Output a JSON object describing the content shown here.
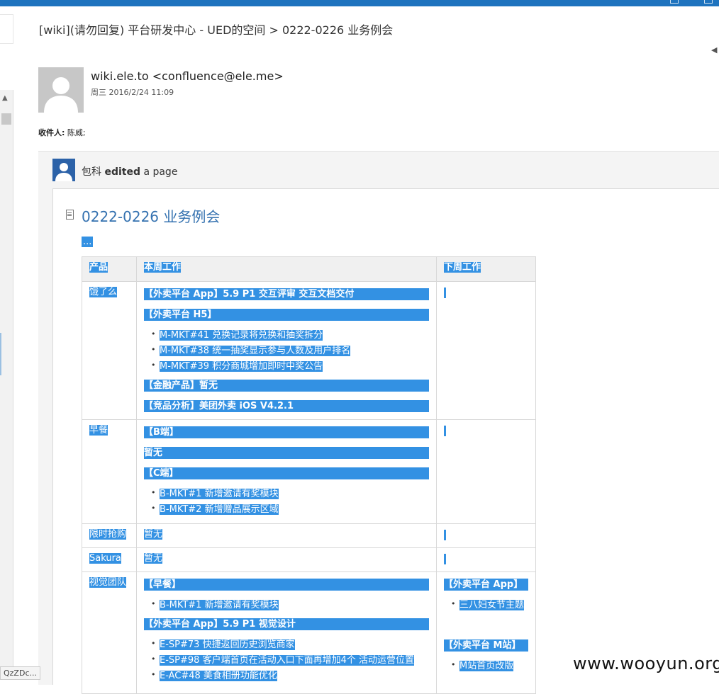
{
  "email": {
    "subject": "[wiki](请勿回复) 平台研发中心 - UED的空间 > 0222-0226 业务例会",
    "sender": "wiki.ele.to <confluence@ele.me>",
    "date": "周三 2016/2/24 11:09",
    "recipients_label": "收件人:",
    "recipients": "陈威;"
  },
  "notification": {
    "editor_name": "包科",
    "action": "edited",
    "object": "a page"
  },
  "page": {
    "title": "0222-0226 业务例会",
    "ellipsis": "..."
  },
  "table": {
    "headers": [
      "产品",
      "本周工作",
      "下周工作"
    ],
    "rows": [
      {
        "product": "饿了么",
        "this_week": {
          "h1": "【外卖平台 App】5.9 P1 交互评审 交互文档交付",
          "h2": "【外卖平台 H5】",
          "items": [
            "M-MKT#41 兑换记录将兑换和抽奖拆分",
            "M-MKT#38 统一抽奖显示参与人数及用户排名",
            "M-MKT#39 积分商城增加即时中奖公告"
          ],
          "h3": "【金融产品】暂无",
          "h4": "【竞品分析】美团外卖 iOS V4.2.1"
        }
      },
      {
        "product": "早餐",
        "this_week": {
          "h1": "【B端】",
          "p1": "暂无",
          "h2": "【C端】",
          "items": [
            "B-MKT#1 新增邀请有奖模块",
            "B-MKT#2 新增赠品展示区域"
          ]
        }
      },
      {
        "product": "限时抢购",
        "this_week": {
          "p1": "暂无"
        }
      },
      {
        "product": "Sakura",
        "this_week": {
          "p1": "暂无"
        }
      },
      {
        "product": "视觉团队",
        "this_week": {
          "h1": "【早餐】",
          "items1": [
            "B-MKT#1 新增邀请有奖模块"
          ],
          "h2": "【外卖平台 App】5.9 P1 视觉设计",
          "items2": [
            "E-SP#73 快捷返回历史浏览商家",
            "E-SP#98 客户端首页在活动入口下面再增加4个 活动运营位置",
            "E-AC#48 美食相册功能优化"
          ]
        },
        "next_week": {
          "h1": "【外卖平台 App】",
          "items1": [
            "三八妇女节主题"
          ],
          "h2": "【外卖平台 M站】",
          "items2": [
            "M站首页改版"
          ]
        }
      }
    ]
  },
  "ui": {
    "tooltip": "QzZDc...",
    "watermark": "www.wooyun.org"
  },
  "colors": {
    "title_bar": "#1e73be",
    "selection": "#3391e3",
    "link": "#3572b0"
  }
}
